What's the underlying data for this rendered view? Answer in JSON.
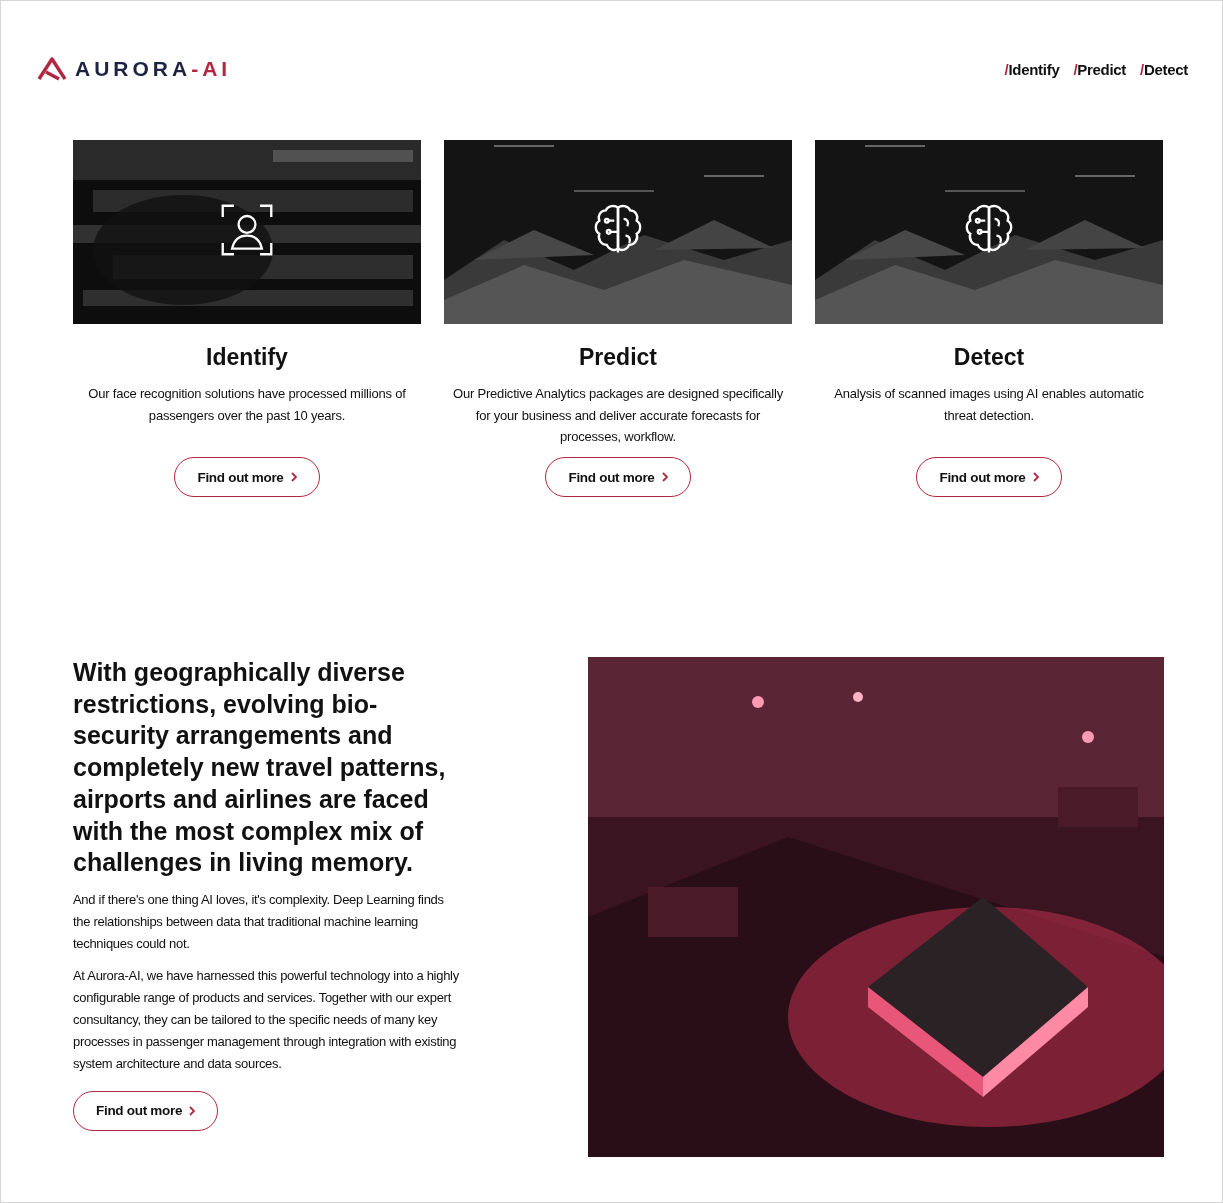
{
  "header": {
    "logo": {
      "name": "AURORA",
      "suffix": "-AI"
    },
    "nav": [
      {
        "mark": "/",
        "label": "Identify"
      },
      {
        "mark": "/",
        "label": "Predict"
      },
      {
        "mark": "/",
        "label": "Detect"
      }
    ]
  },
  "cards": [
    {
      "title": "Identify",
      "text": "Our face recognition solutions have processed millions of passengers over the past 10 years.",
      "button": "Find out more"
    },
    {
      "title": "Predict",
      "text": "Our Predictive Analytics packages are designed specifically for your business and deliver accurate forecasts for processes, workflow.",
      "button": "Find out more"
    },
    {
      "title": "Detect",
      "text": "Analysis of scanned images using AI enables automatic threat detection.",
      "button": "Find out more"
    }
  ],
  "feature": {
    "heading": "With geographically diverse restrictions, evolving bio-security arrangements and completely new travel patterns, airports and airlines are faced with the most complex mix of challenges in living memory.",
    "paragraphs": [
      "And if there's one thing AI loves, it's complexity. Deep Learning finds the relationships between data that traditional machine learning techniques could not.",
      "At Aurora-AI, we have harnessed this powerful technology into a highly configurable range of products and services. Together with our expert consultancy, they can be tailored to the specific needs of many key processes in passenger management through integration with existing system architecture and data sources."
    ],
    "button": "Find out more"
  }
}
